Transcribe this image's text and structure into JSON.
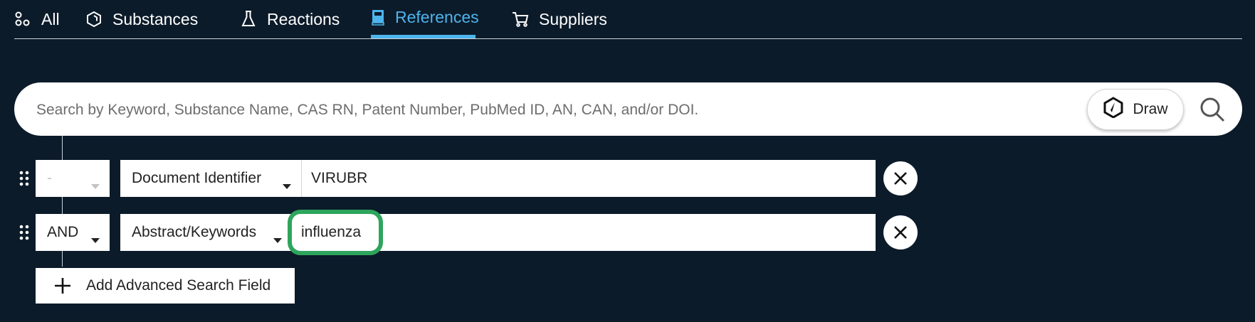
{
  "tabs": [
    {
      "label": "All",
      "icon": "all-icon"
    },
    {
      "label": "Substances",
      "icon": "substance-hexagon-icon"
    },
    {
      "label": "Reactions",
      "icon": "flask-icon"
    },
    {
      "label": "References",
      "icon": "book-icon",
      "active": true
    },
    {
      "label": "Suppliers",
      "icon": "cart-icon"
    }
  ],
  "colors": {
    "background": "#0c1b2a",
    "accent": "#4db4ec",
    "highlight": "#2ea55c"
  },
  "search": {
    "placeholder": "Search by Keyword, Substance Name, CAS RN, Patent Number, PubMed ID, AN, CAN, and/or DOI.",
    "draw_label": "Draw"
  },
  "rows": [
    {
      "operator": "-",
      "field": "Document Identifier",
      "value": "VIRUBR"
    },
    {
      "operator": "AND",
      "field": "Abstract/Keywords",
      "value": "influenza"
    }
  ],
  "add_field_label": "Add Advanced Search Field"
}
